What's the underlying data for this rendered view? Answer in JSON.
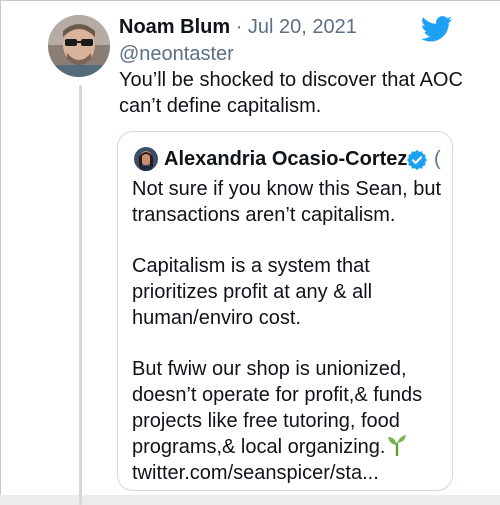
{
  "tweet": {
    "author_name": "Noam Blum",
    "separator": "·",
    "date": "Jul 20, 2021",
    "handle": "@neontaster",
    "text_lines": [
      "You’ll be shocked to discover that AOC",
      "can’t define capitalism."
    ],
    "avatar": "profile-photo",
    "platform_icon": "twitter-bird-icon",
    "brand_color": "#1DA1F2"
  },
  "quoted_tweet": {
    "author_name": "Alexandria Ocasio-Cortez",
    "verified_icon": "verified-badge-icon",
    "truncated_handle": "(",
    "avatar": "profile-photo",
    "paragraphs": [
      [
        "Not sure if you know this Sean, but",
        "transactions aren’t capitalism."
      ],
      [
        "Capitalism is a system that",
        "prioritizes profit at any & all",
        "human/enviro cost."
      ],
      [
        "But fwiw our shop is unionized,",
        "doesn’t operate for profit,& funds",
        "projects like free tutoring, food",
        "programs,& local organizing."
      ]
    ],
    "emoji": "seedling-emoji",
    "link_text": "twitter.com/seanspicer/sta..."
  }
}
